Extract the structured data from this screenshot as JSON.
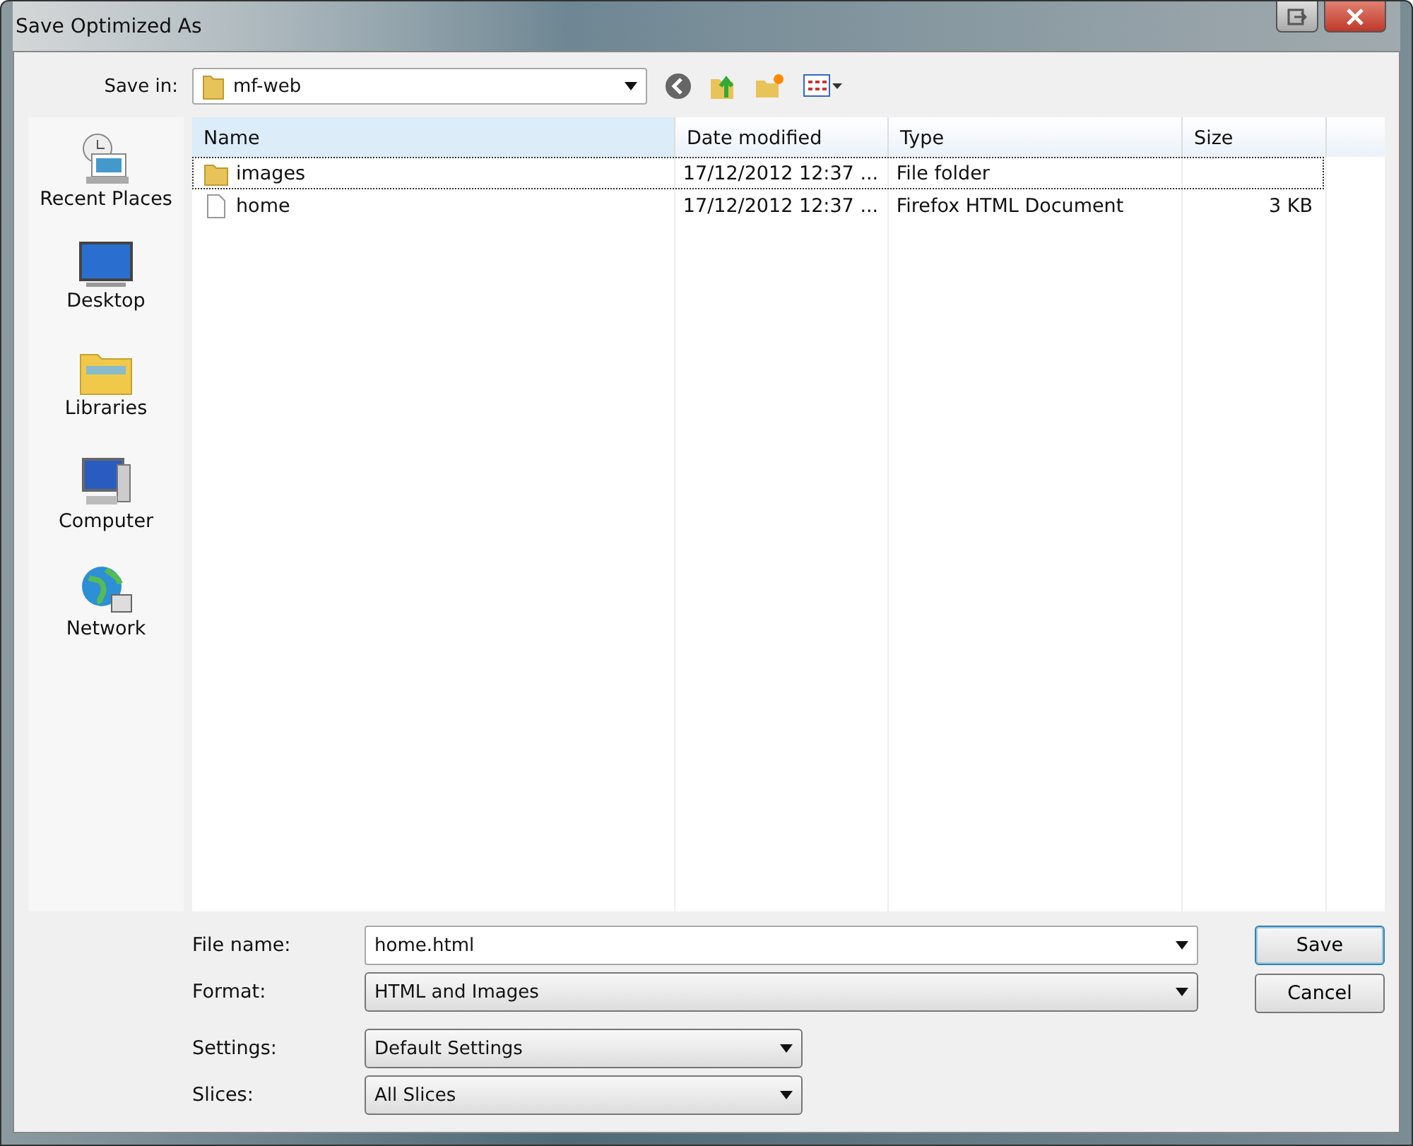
{
  "window": {
    "title": "Save Optimized As"
  },
  "save_in": {
    "label": "Save in:",
    "value": "mf-web"
  },
  "places": [
    {
      "label": "Recent Places",
      "kind": "recent"
    },
    {
      "label": "Desktop",
      "kind": "desktop"
    },
    {
      "label": "Libraries",
      "kind": "libraries"
    },
    {
      "label": "Computer",
      "kind": "computer"
    },
    {
      "label": "Network",
      "kind": "network"
    }
  ],
  "table": {
    "columns": [
      "Name",
      "Date modified",
      "Type",
      "Size"
    ],
    "rows": [
      {
        "name": "images",
        "kind": "folder",
        "date": "17/12/2012 12:37 ...",
        "type": "File folder",
        "size": "",
        "focused": true
      },
      {
        "name": "home",
        "kind": "file",
        "date": "17/12/2012 12:37 ...",
        "type": "Firefox HTML Document",
        "size": "3 KB",
        "focused": false
      }
    ]
  },
  "fields": [
    {
      "label": "File name:",
      "value": "home.html",
      "kind": "combo"
    },
    {
      "label": "Format:",
      "value": "HTML and Images",
      "kind": "select"
    }
  ],
  "options": [
    {
      "label": "Settings:",
      "value": "Default Settings"
    },
    {
      "label": "Slices:",
      "value": "All Slices"
    }
  ],
  "buttons": [
    {
      "label": "Save",
      "default": true
    },
    {
      "label": "Cancel",
      "default": false
    }
  ]
}
